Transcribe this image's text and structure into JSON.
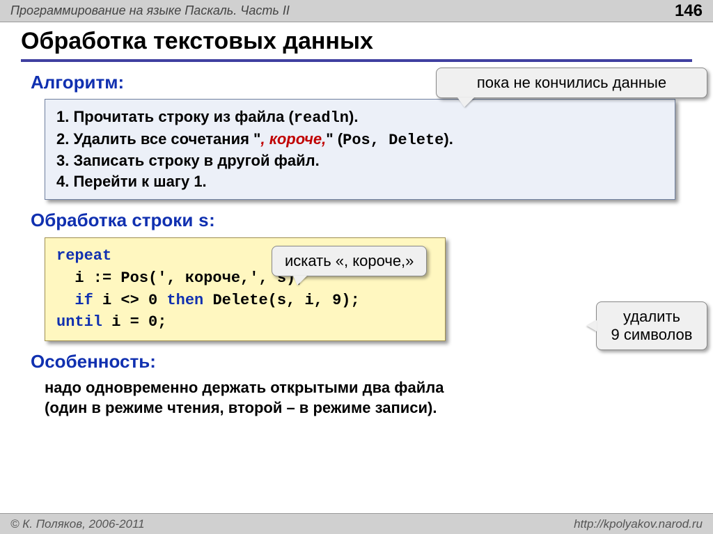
{
  "header": {
    "course": "Программирование на языке Паскаль. Часть II",
    "page": "146"
  },
  "title": "Обработка текстовых данных",
  "algorithm": {
    "heading": "Алгоритм:",
    "step1_a": "1. Прочитать строку из файла (",
    "step1_code": "readln",
    "step1_b": ").",
    "step2_a": "2. Удалить все сочетания \"",
    "step2_red": ", короче,",
    "step2_b": "\" (",
    "step2_code": "Pos, Delete",
    "step2_c": ").",
    "step3": "3. Записать строку в другой файл.",
    "step4": "4. Перейти к шагу 1."
  },
  "callouts": {
    "top": "пока не кончились данные",
    "mid": "искать «, короче,»",
    "right_l1": "удалить",
    "right_l2": "9 символов"
  },
  "processing": {
    "heading_a": "Обработка строки ",
    "heading_s": "s",
    "heading_b": ":"
  },
  "code": {
    "l1": "repeat",
    "l2": "  i := Pos(', короче,', s);",
    "l3_a": "  ",
    "l3_if": "if",
    "l3_b": " i <> 0 ",
    "l3_then": "then",
    "l3_c": " Delete(s, i, 9);",
    "l4_a": "until",
    "l4_b": " i = 0;"
  },
  "feature": {
    "heading": "Особенность:",
    "line1": "надо одновременно держать открытыми два файла",
    "line2": "(один в режиме чтения, второй – в режиме записи)."
  },
  "footer": {
    "left": "© К. Поляков, 2006-2011",
    "right": "http://kpolyakov.narod.ru"
  }
}
